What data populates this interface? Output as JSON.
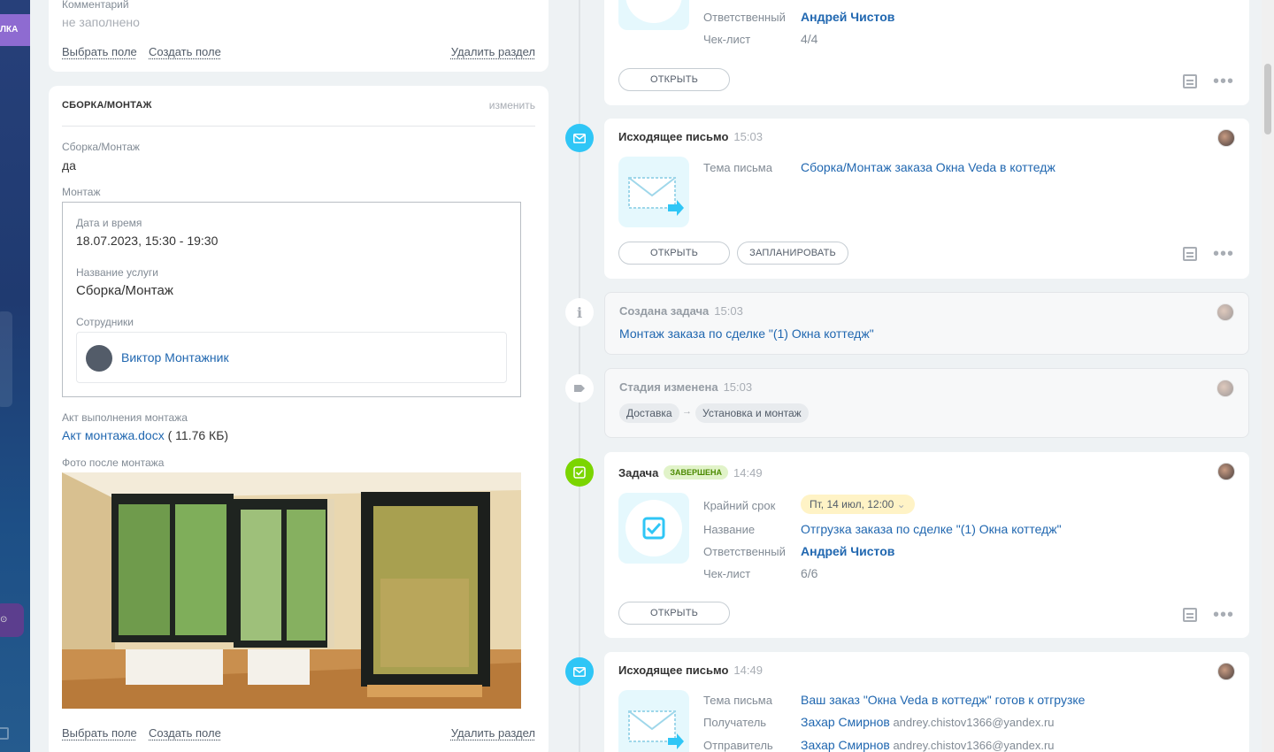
{
  "left": {
    "comment_card": {
      "label": "Комментарий",
      "value": "не заполнено",
      "select_field": "Выбрать поле",
      "create_field": "Создать поле",
      "delete_section": "Удалить раздел"
    },
    "assembly_card": {
      "title": "СБОРКА/МОНТАЖ",
      "edit": "изменить",
      "f1_label": "Сборка/Монтаж",
      "f1_value": "да",
      "mount_label": "Монтаж",
      "datetime_label": "Дата и время",
      "datetime_value": "18.07.2023, 15:30 - 19:30",
      "service_label": "Название услуги",
      "service_value": "Сборка/Монтаж",
      "employees_label": "Сотрудники",
      "employee_name": "Виктор Монтажник",
      "act_label": "Акт выполнения монтажа",
      "act_file": "Акт монтажа.docx",
      "act_size": " ( 11.76 КБ)",
      "photo_label": "Фото после монтажа",
      "select_field": "Выбрать поле",
      "create_field": "Создать поле",
      "delete_section": "Удалить раздел"
    }
  },
  "rail": {
    "tag_text": "ЛКА"
  },
  "timeline": {
    "top_task": {
      "resp_label": "Ответственный",
      "resp_value": "Андрей Чистов",
      "check_label": "Чек-лист",
      "check_value": "4/4",
      "open": "ОТКРЫТЬ"
    },
    "email1": {
      "title": "Исходящее письмо",
      "time": "15:03",
      "subject_label": "Тема письма",
      "subject_value": "Сборка/Монтаж заказа Окна Veda в коттедж",
      "open": "ОТКРЫТЬ",
      "plan": "ЗАПЛАНИРОВАТЬ"
    },
    "created": {
      "title": "Создана задача",
      "time": "15:03",
      "link": "Монтаж заказа по сделке \"(1) Окна коттедж\""
    },
    "stage": {
      "title": "Стадия изменена",
      "time": "15:03",
      "from": "Доставка",
      "arrow": "→",
      "to": "Установка и монтаж"
    },
    "task": {
      "title": "Задача",
      "badge": "ЗАВЕРШЕНА",
      "time": "14:49",
      "deadline_label": "Крайний срок",
      "deadline_value": "Пт, 14 июл, 12:00",
      "name_label": "Название",
      "name_value": "Отгрузка заказа по сделке \"(1) Окна коттедж\"",
      "resp_label": "Ответственный",
      "resp_value": "Андрей Чистов",
      "check_label": "Чек-лист",
      "check_value": "6/6",
      "open": "ОТКРЫТЬ"
    },
    "email2": {
      "title": "Исходящее письмо",
      "time": "14:49",
      "subject_label": "Тема письма",
      "subject_value": "Ваш заказ \"Окна Veda в коттедж\" готов к отгрузке",
      "to_label": "Получатель",
      "to_name": "Захар Смирнов",
      "to_email": " andrey.chistov1366@yandex.ru",
      "from_label": "Отправитель",
      "from_name": "Захар Смирнов",
      "from_email": " andrey.chistov1366@yandex.ru"
    }
  },
  "icons": [
    "envelope-icon",
    "info-icon",
    "tag-icon",
    "check-icon",
    "note-icon",
    "more-icon",
    "chevron-down-icon"
  ]
}
